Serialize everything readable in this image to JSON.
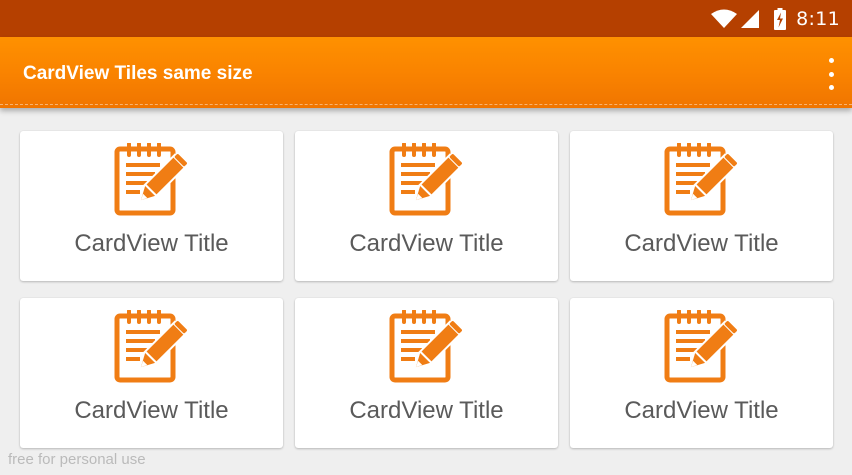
{
  "status_bar": {
    "time": "8:11",
    "icons": [
      "wifi-icon",
      "cell-signal-icon",
      "battery-charging-icon"
    ]
  },
  "app_bar": {
    "title": "CardView Tiles same size",
    "menu_icon": "overflow-menu-icon"
  },
  "cards": [
    {
      "icon": "notepad-pencil-icon",
      "title": "CardView Title"
    },
    {
      "icon": "notepad-pencil-icon",
      "title": "CardView Title"
    },
    {
      "icon": "notepad-pencil-icon",
      "title": "CardView Title"
    },
    {
      "icon": "notepad-pencil-icon",
      "title": "CardView Title"
    },
    {
      "icon": "notepad-pencil-icon",
      "title": "CardView Title"
    },
    {
      "icon": "notepad-pencil-icon",
      "title": "CardView Title"
    }
  ],
  "watermark": "free for personal use",
  "colors": {
    "status_bar": "#b54000",
    "app_bar": "#fb8a00",
    "icon": "#f07d14",
    "card_title": "#5a5a5a",
    "background": "#efefef"
  }
}
